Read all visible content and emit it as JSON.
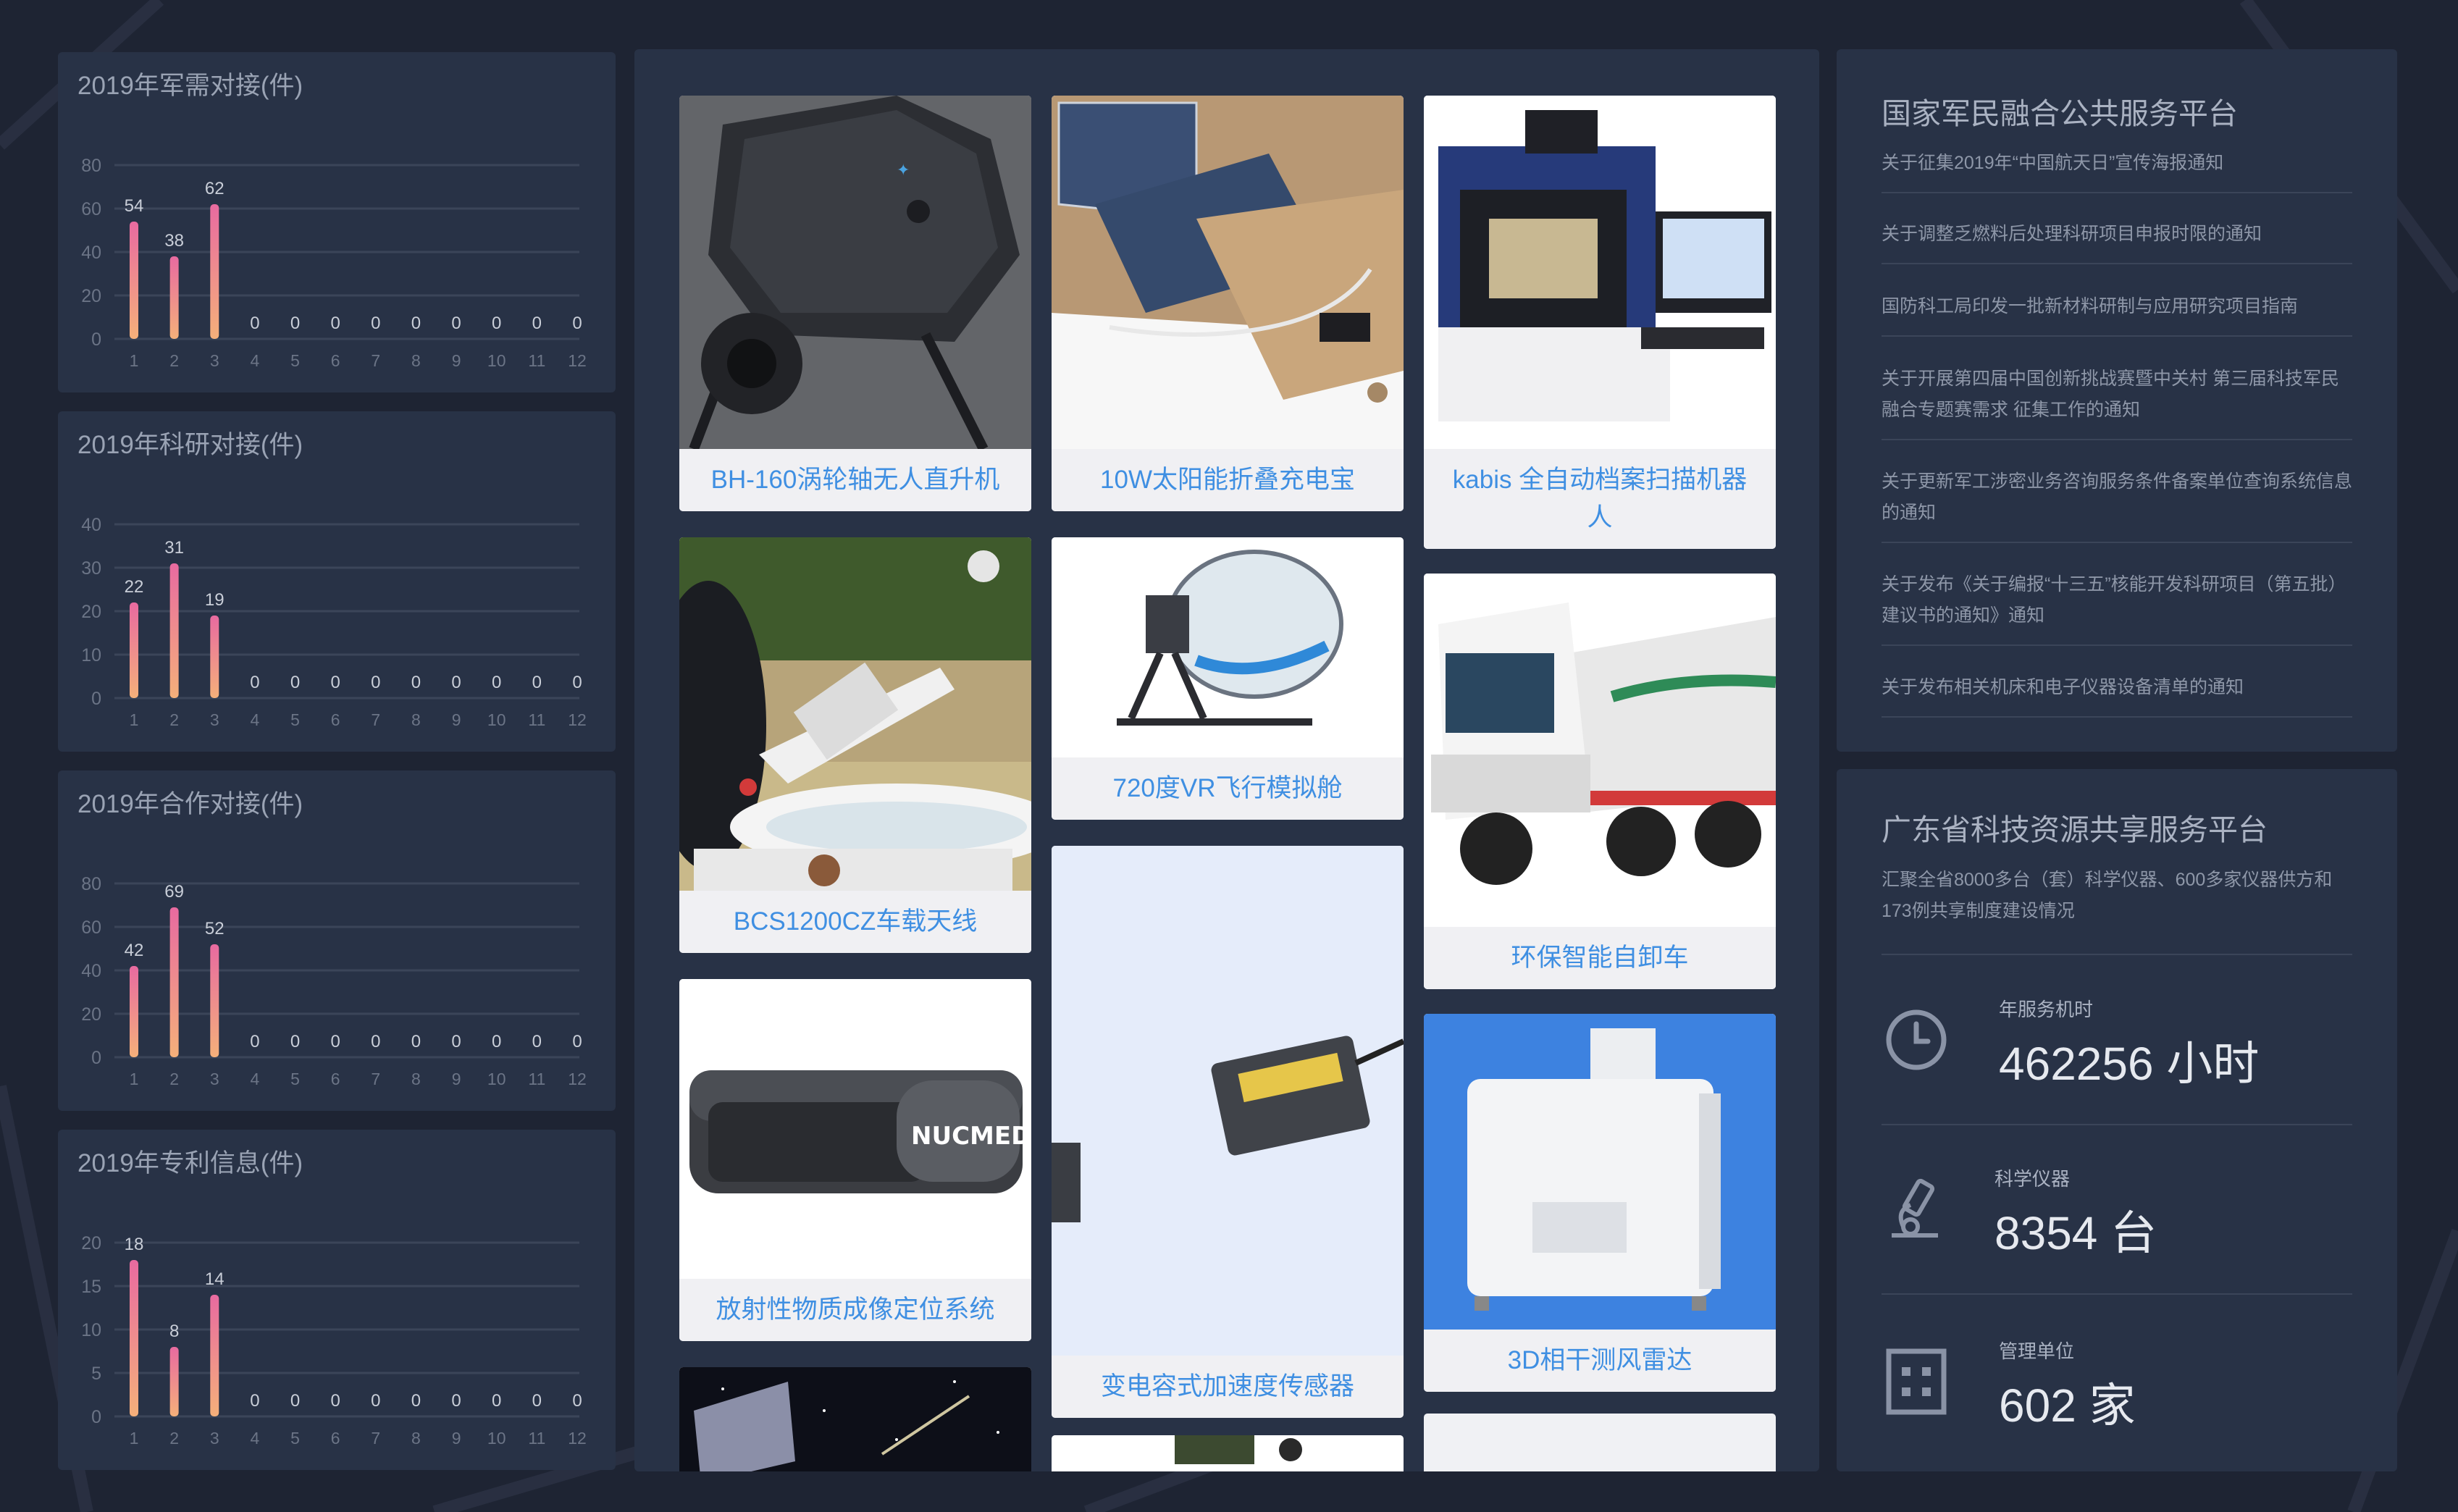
{
  "left": {
    "charts": [
      {
        "title": "2019年军需对接(件)"
      },
      {
        "title": "2019年科研对接(件)"
      },
      {
        "title": "2019年合作对接(件)"
      },
      {
        "title": "2019年专利信息(件)"
      }
    ]
  },
  "chart_data": [
    {
      "type": "bar",
      "title": "2019年军需对接(件)",
      "categories": [
        "1",
        "2",
        "3",
        "4",
        "5",
        "6",
        "7",
        "8",
        "9",
        "10",
        "11",
        "12"
      ],
      "values": [
        54,
        38,
        62,
        0,
        0,
        0,
        0,
        0,
        0,
        0,
        0,
        0
      ],
      "ylim": [
        0,
        80
      ],
      "yticks": [
        0,
        20,
        40,
        60,
        80
      ],
      "grid": true,
      "colors": [
        "#e86aa0",
        "#f5b07a"
      ]
    },
    {
      "type": "bar",
      "title": "2019年科研对接(件)",
      "categories": [
        "1",
        "2",
        "3",
        "4",
        "5",
        "6",
        "7",
        "8",
        "9",
        "10",
        "11",
        "12"
      ],
      "values": [
        22,
        31,
        19,
        0,
        0,
        0,
        0,
        0,
        0,
        0,
        0,
        0
      ],
      "ylim": [
        0,
        40
      ],
      "yticks": [
        0,
        10,
        20,
        30,
        40
      ],
      "grid": true,
      "colors": [
        "#e86aa0",
        "#f5b07a"
      ]
    },
    {
      "type": "bar",
      "title": "2019年合作对接(件)",
      "categories": [
        "1",
        "2",
        "3",
        "4",
        "5",
        "6",
        "7",
        "8",
        "9",
        "10",
        "11",
        "12"
      ],
      "values": [
        42,
        69,
        52,
        0,
        0,
        0,
        0,
        0,
        0,
        0,
        0,
        0
      ],
      "ylim": [
        0,
        80
      ],
      "yticks": [
        0,
        20,
        40,
        60,
        80
      ],
      "grid": true,
      "colors": [
        "#e86aa0",
        "#f5b07a"
      ]
    },
    {
      "type": "bar",
      "title": "2019年专利信息(件)",
      "categories": [
        "1",
        "2",
        "3",
        "4",
        "5",
        "6",
        "7",
        "8",
        "9",
        "10",
        "11",
        "12"
      ],
      "values": [
        18,
        8,
        14,
        0,
        0,
        0,
        0,
        0,
        0,
        0,
        0,
        0
      ],
      "ylim": [
        0,
        20
      ],
      "yticks": [
        0,
        5,
        10,
        15,
        20
      ],
      "grid": true,
      "colors": [
        "#e86aa0",
        "#f5b07a"
      ]
    }
  ],
  "products": [
    {
      "label": "BH-160涡轮轴无人直升机"
    },
    {
      "label": "BCS1200CZ车载天线"
    },
    {
      "label": "放射性物质成像定位系统"
    },
    {
      "label": ""
    },
    {
      "label": "10W太阳能折叠充电宝"
    },
    {
      "label": "720度VR飞行模拟舱"
    },
    {
      "label": "变电容式加速度传感器"
    },
    {
      "label": ""
    },
    {
      "label": "kabis 全自动档案扫描机器人"
    },
    {
      "label": "环保智能自卸车"
    },
    {
      "label": "3D相干测风雷达"
    },
    {
      "label": ""
    }
  ],
  "platform1": {
    "title": "国家军民融合公共服务平台",
    "news": [
      "关于征集2019年“中国航天日”宣传海报通知",
      "关于调整乏燃料后处理科研项目申报时限的通知",
      "国防科工局印发一批新材料研制与应用研究项目指南",
      "关于开展第四届中国创新挑战赛暨中关村 第三届科技军民融合专题赛需求 征集工作的通知",
      "关于更新军工涉密业务咨询服务条件备案单位查询系统信息的通知",
      "关于发布《关于编报“十三五”核能开发科研项目（第五批）建议书的通知》通知",
      "关于发布相关机床和电子仪器设备清单的通知"
    ]
  },
  "platform2": {
    "title": "广东省科技资源共享服务平台",
    "desc": "汇聚全省8000多台（套）科学仪器、600多家仪器供方和173例共享制度建设情况",
    "stats": [
      {
        "label": "年服务机时",
        "value": "462256 小时",
        "icon": "clock-icon"
      },
      {
        "label": "科学仪器",
        "value": "8354 台",
        "icon": "microscope-icon"
      },
      {
        "label": "管理单位",
        "value": "602 家",
        "icon": "building-icon"
      }
    ]
  },
  "colors": {
    "page": "#1e2433",
    "panel": "#283246",
    "accent": "#3f8fe2",
    "bar_top": "#e86aa0",
    "bar_bottom": "#f5b07a"
  }
}
